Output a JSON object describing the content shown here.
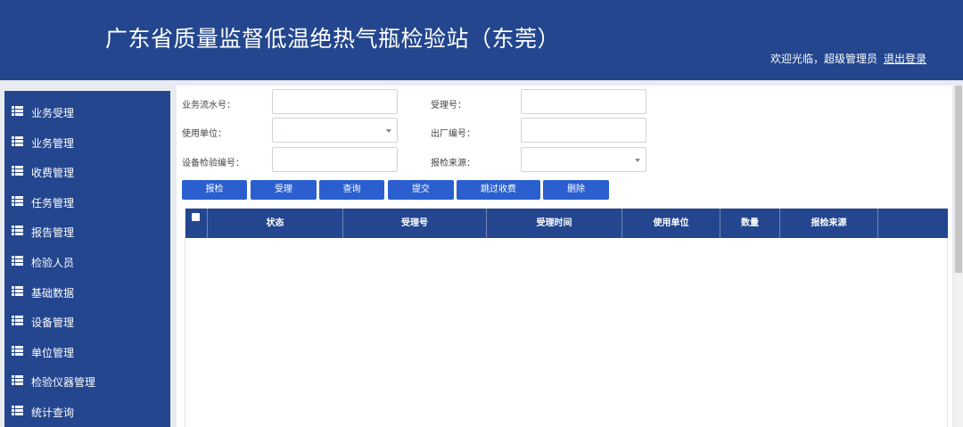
{
  "header": {
    "title": "广东省质量监督低温绝热气瓶检验站（东莞）",
    "welcome": "欢迎光临，超级管理员",
    "logout": "退出登录"
  },
  "sidebar": {
    "items": [
      {
        "label": "业务受理",
        "icon": "list-icon"
      },
      {
        "label": "业务管理",
        "icon": "list-icon"
      },
      {
        "label": "收费管理",
        "icon": "list-icon"
      },
      {
        "label": "任务管理",
        "icon": "list-icon"
      },
      {
        "label": "报告管理",
        "icon": "list-icon"
      },
      {
        "label": "检验人员",
        "icon": "list-icon"
      },
      {
        "label": "基础数据",
        "icon": "list-icon"
      },
      {
        "label": "设备管理",
        "icon": "list-icon"
      },
      {
        "label": "单位管理",
        "icon": "list-icon"
      },
      {
        "label": "检验仪器管理",
        "icon": "list-icon"
      },
      {
        "label": "统计查询",
        "icon": "list-icon"
      }
    ]
  },
  "form": {
    "serial_no": {
      "label": "业务流水号：",
      "value": ""
    },
    "accept_no": {
      "label": "受理号：",
      "value": ""
    },
    "user_unit": {
      "label": "使用单位：",
      "value": ""
    },
    "factory_no": {
      "label": "出厂编号：",
      "value": ""
    },
    "equip_no": {
      "label": "设备检验编号：",
      "value": ""
    },
    "source": {
      "label": "报检来源：",
      "value": ""
    }
  },
  "toolbar": {
    "report": "报检",
    "accept": "受理",
    "query": "查询",
    "submit": "提交",
    "skip_fee": "跳过收费",
    "delete": "删除"
  },
  "table": {
    "columns": [
      "状态",
      "受理号",
      "受理时间",
      "使用单位",
      "数量",
      "报检来源",
      ""
    ],
    "rows": []
  },
  "colors": {
    "primary": "#23468f",
    "button": "#2b5fd0",
    "background": "#e8ebf0"
  }
}
